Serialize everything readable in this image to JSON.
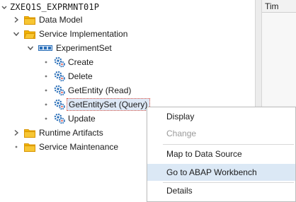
{
  "tree": {
    "root": {
      "label": "ZXEQ1S_EXPRMNT01P",
      "icon": "project-icon"
    },
    "nodes": [
      {
        "label": "Data Model",
        "icon": "folder-icon",
        "expanded": false
      },
      {
        "label": "Service Implementation",
        "icon": "folder-icon",
        "expanded": true
      },
      {
        "label": "ExperimentSet",
        "icon": "entity-set-icon",
        "expanded": true
      },
      {
        "label": "Create",
        "icon": "operation-icon"
      },
      {
        "label": "Delete",
        "icon": "operation-icon"
      },
      {
        "label": "GetEntity (Read)",
        "icon": "operation-icon"
      },
      {
        "label": "GetEntitySet (Query)",
        "icon": "operation-icon",
        "selected": true
      },
      {
        "label": "Update",
        "icon": "operation-icon"
      },
      {
        "label": "Runtime Artifacts",
        "icon": "folder-icon",
        "expanded": false
      },
      {
        "label": "Service Maintenance",
        "icon": "folder-icon"
      }
    ]
  },
  "right_pane": {
    "column_header": "Tim"
  },
  "context_menu": {
    "items": [
      {
        "label": "Display",
        "enabled": true
      },
      {
        "label": "Change",
        "enabled": false
      },
      {
        "label": "Map to Data Source",
        "enabled": true
      },
      {
        "label": "Go to ABAP Workbench",
        "enabled": true,
        "highlighted": true
      },
      {
        "label": "Details",
        "enabled": true
      }
    ]
  },
  "colors": {
    "folder": "#f0b400",
    "folder_dark": "#d89400",
    "gear": "#2a6fb8",
    "gear_accent": "#e34234",
    "selection": "#dde8f6",
    "menu_highlight": "#dbe8f5",
    "disabled_text": "#9a9a9a"
  }
}
